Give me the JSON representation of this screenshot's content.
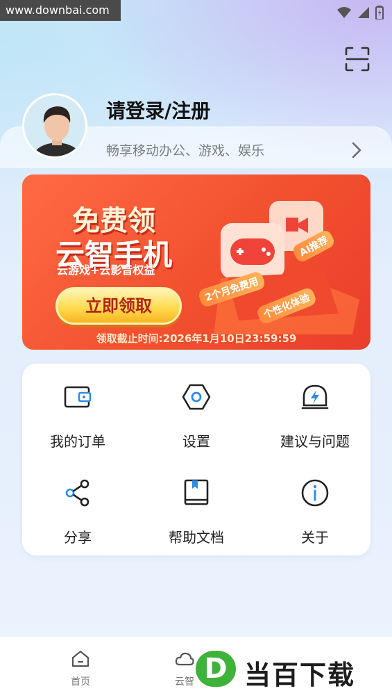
{
  "watermark": {
    "url": "www.downbai.com"
  },
  "status_bar": {
    "icons": [
      "wifi-icon",
      "signal-icon",
      "battery-icon"
    ]
  },
  "header": {
    "scan_icon": "scan-icon"
  },
  "profile": {
    "title": "请登录/注册",
    "subtitle": "畅享移动办公、游戏、娱乐"
  },
  "banner": {
    "title_line1": "免费领",
    "title_line2": "云智手机",
    "subtitle": "云游戏+云影音权益",
    "claim_button": "立即领取",
    "deadline": "领取截止时间:2026年1月10日23:59:59",
    "tags": [
      "AI推荐",
      "2个月免费用",
      "个性化体验"
    ]
  },
  "grid": {
    "items": [
      {
        "label": "我的订单",
        "icon": "wallet-icon"
      },
      {
        "label": "设置",
        "icon": "hexagon-settings-icon"
      },
      {
        "label": "建议与问题",
        "icon": "feedback-lightning-icon"
      },
      {
        "label": "分享",
        "icon": "share-icon"
      },
      {
        "label": "帮助文档",
        "icon": "book-icon"
      },
      {
        "label": "关于",
        "icon": "info-icon"
      }
    ]
  },
  "bottom_nav": {
    "items": [
      {
        "label": "首页",
        "icon": "home-icon"
      },
      {
        "label": "云智",
        "icon": "cloud-home-icon"
      }
    ]
  },
  "logo_watermark": {
    "text": "当百下载",
    "letter": "D"
  },
  "colors": {
    "accent": "#2f8ae8",
    "banner": "#f2502f",
    "button": "#ffd84a"
  }
}
